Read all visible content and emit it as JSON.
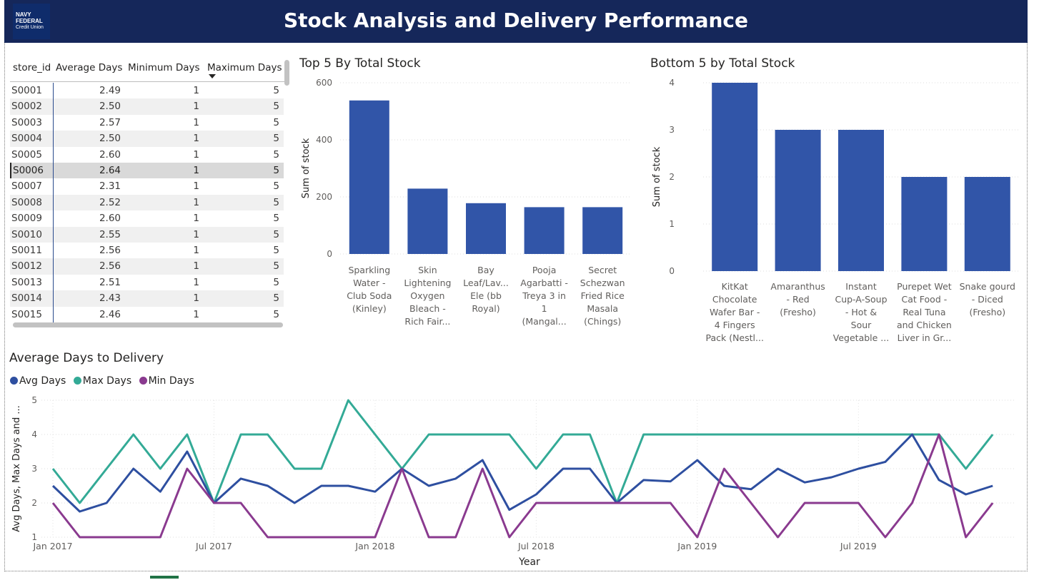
{
  "header": {
    "title": "Stock Analysis and Delivery Performance",
    "logo_line1": "NAVY",
    "logo_line2": "FEDERAL",
    "logo_line3": "Credit Union",
    "bg_color": "#15275a"
  },
  "table": {
    "columns": [
      "store_id",
      "Average Days",
      "Minimum Days",
      "Maximum Days"
    ],
    "sorted_column": "Maximum Days",
    "rows": [
      [
        "S0001",
        "2.49",
        "1",
        "5"
      ],
      [
        "S0002",
        "2.50",
        "1",
        "5"
      ],
      [
        "S0003",
        "2.57",
        "1",
        "5"
      ],
      [
        "S0004",
        "2.50",
        "1",
        "5"
      ],
      [
        "S0005",
        "2.60",
        "1",
        "5"
      ],
      [
        "S0006",
        "2.64",
        "1",
        "5"
      ],
      [
        "S0007",
        "2.31",
        "1",
        "5"
      ],
      [
        "S0008",
        "2.52",
        "1",
        "5"
      ],
      [
        "S0009",
        "2.60",
        "1",
        "5"
      ],
      [
        "S0010",
        "2.55",
        "1",
        "5"
      ],
      [
        "S0011",
        "2.56",
        "1",
        "5"
      ],
      [
        "S0012",
        "2.56",
        "1",
        "5"
      ],
      [
        "S0013",
        "2.51",
        "1",
        "5"
      ],
      [
        "S0014",
        "2.43",
        "1",
        "5"
      ],
      [
        "S0015",
        "2.46",
        "1",
        "5"
      ]
    ],
    "selected_row": "S0006"
  },
  "chart_data": [
    {
      "type": "bar",
      "title": "Top 5 By Total Stock",
      "ylabel": "Sum of stock",
      "ylim": [
        0,
        600
      ],
      "yticks": [
        "0",
        "200",
        "400",
        "600"
      ],
      "color": "#3155a8",
      "categories": [
        [
          "Sparkling",
          "Water -",
          "Club Soda",
          "(Kinley)"
        ],
        [
          "Skin",
          "Lightening",
          "Oxygen",
          "Bleach -",
          "Rich Fair..."
        ],
        [
          "Bay",
          "Leaf/Lav...",
          "Ele (bb",
          "Royal)"
        ],
        [
          "Pooja",
          "Agarbatti -",
          "Treya 3 in",
          "1",
          "(Mangal..."
        ],
        [
          "Secret",
          "Schezwan",
          "Fried Rice",
          "Masala",
          "(Chings)"
        ]
      ],
      "values": [
        538,
        229,
        178,
        164,
        164
      ]
    },
    {
      "type": "bar",
      "title": "Bottom 5 by Total Stock",
      "ylabel": "Sum of stock",
      "ylim": [
        0,
        4
      ],
      "yticks": [
        "0",
        "1",
        "2",
        "3",
        "4"
      ],
      "color": "#3155a8",
      "categories": [
        [
          "KitKat",
          "Chocolate",
          "Wafer Bar -",
          "4 Fingers",
          "Pack (Nestl..."
        ],
        [
          "Amaranthus",
          "- Red",
          "(Fresho)"
        ],
        [
          "Instant",
          "Cup-A-Soup",
          "- Hot &",
          "Sour",
          "Vegetable ..."
        ],
        [
          "Purepet Wet",
          "Cat Food -",
          "Real Tuna",
          "and Chicken",
          "Liver in Gr..."
        ],
        [
          "Snake gourd",
          "- Diced",
          "(Fresho)"
        ]
      ],
      "values": [
        4,
        3,
        3,
        2,
        2
      ]
    },
    {
      "type": "line",
      "title": "Average Days to Delivery",
      "xlabel": "Year",
      "ylabel": "Avg Days, Max Days and ...",
      "ylim": [
        1,
        5
      ],
      "yticks": [
        "1",
        "2",
        "3",
        "4",
        "5"
      ],
      "xticks": [
        "Jan 2017",
        "Jul 2017",
        "Jan 2018",
        "Jul 2018",
        "Jan 2019",
        "Jul 2019"
      ],
      "x_start": "2017-01",
      "x_end": "2019-12",
      "series": [
        {
          "name": "Avg Days",
          "color": "#2e4fa0",
          "values": [
            2.5,
            1.75,
            2.0,
            3.0,
            2.33,
            3.5,
            2.0,
            2.71,
            2.5,
            2.0,
            2.5,
            2.5,
            2.33,
            3.0,
            2.5,
            2.71,
            3.25,
            1.8,
            2.25,
            3.0,
            3.0,
            2.0,
            2.67,
            2.63,
            3.25,
            2.5,
            2.4,
            3.0,
            2.6,
            2.75,
            3.0,
            3.2,
            4.0,
            2.67,
            2.25,
            2.5
          ]
        },
        {
          "name": "Max Days",
          "color": "#33aa96",
          "values": [
            3,
            2,
            3,
            4,
            3,
            4,
            2,
            4,
            4,
            3,
            3,
            5,
            4,
            3,
            4,
            4,
            4,
            4,
            3,
            4,
            4,
            2,
            4,
            4,
            4,
            4,
            4,
            4,
            4,
            4,
            4,
            4,
            4,
            4,
            3,
            4
          ]
        },
        {
          "name": "Min Days",
          "color": "#8a3a8f",
          "values": [
            2,
            1,
            1,
            1,
            1,
            3,
            2,
            2,
            1,
            1,
            1,
            1,
            1,
            3,
            1,
            1,
            3,
            1,
            2,
            2,
            2,
            2,
            2,
            2,
            1,
            3,
            2,
            1,
            2,
            2,
            2,
            1,
            2,
            4,
            1,
            2,
            2
          ]
        }
      ]
    }
  ]
}
